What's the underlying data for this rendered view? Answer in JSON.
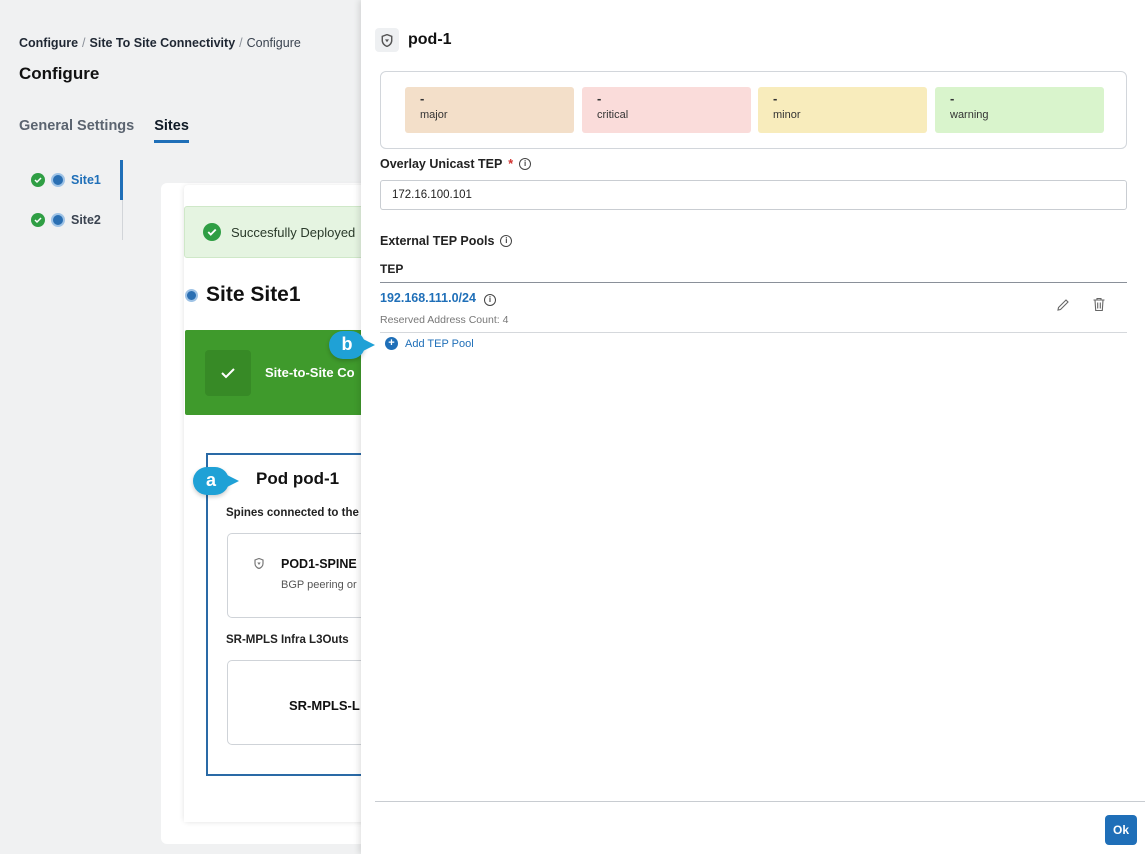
{
  "breadcrumb": {
    "part1": "Configure",
    "part2": "Site To Site Connectivity",
    "part3": "Configure",
    "separator": "/"
  },
  "page_title": "Configure",
  "tabs": [
    {
      "label": "General Settings"
    },
    {
      "label": "Sites"
    }
  ],
  "sites": [
    {
      "label": "Site1"
    },
    {
      "label": "Site2"
    }
  ],
  "banner": {
    "text": "Succesfully Deployed"
  },
  "site_heading": "Site Site1",
  "status_box": {
    "text": "Site-to-Site Co"
  },
  "pod": {
    "title": "Pod pod-1",
    "spines_label": "Spines connected to the",
    "spine_name": "POD1-SPINE",
    "spine_sub": "BGP peering or",
    "srmpls_label": "SR-MPLS Infra L3Outs",
    "srmpls_name": "SR-MPLS-L"
  },
  "drawer": {
    "title": "pod-1",
    "faults": [
      {
        "value": "-",
        "label": "major",
        "color": "#f3dfc9"
      },
      {
        "value": "-",
        "label": "critical",
        "color": "#fadcda"
      },
      {
        "value": "-",
        "label": "minor",
        "color": "#f8ecbc"
      },
      {
        "value": "-",
        "label": "warning",
        "color": "#d9f4cc"
      }
    ],
    "overlay_label": "Overlay Unicast TEP",
    "required_mark": "*",
    "overlay_value": "172.16.100.101",
    "external_label": "External TEP Pools",
    "tep_column": "TEP",
    "tep_pool": {
      "address": "192.168.111.0/24",
      "sub": "Reserved Address Count: 4"
    },
    "add_label": "Add TEP Pool",
    "ok_label": "Ok",
    "info_glyph": "i"
  },
  "callouts": {
    "a": "a",
    "b": "b"
  },
  "colors": {
    "accent": "#1f6fb8",
    "success": "#2f9e44",
    "callout": "#1fa1d6"
  }
}
